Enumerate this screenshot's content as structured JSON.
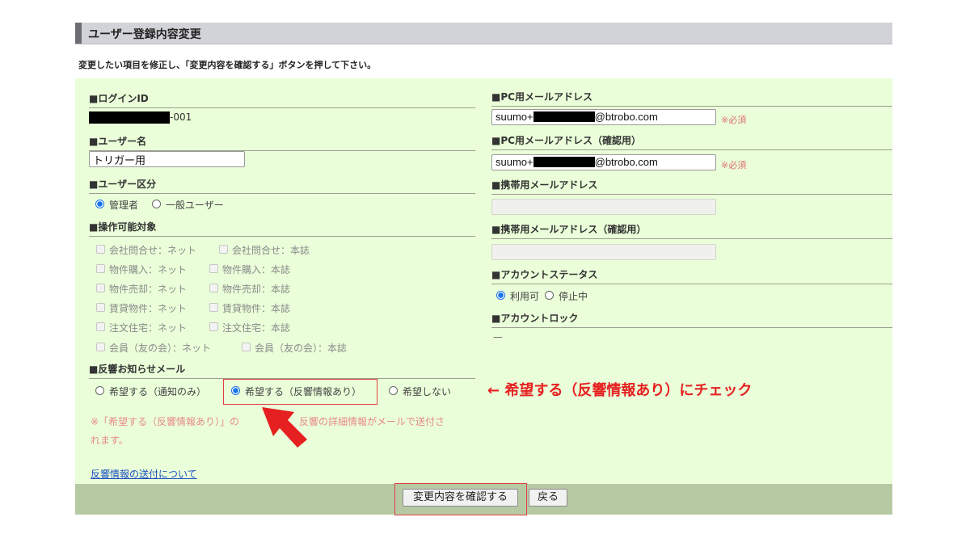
{
  "title": "ユーザー登録内容変更",
  "instruction": "変更したい項目を修正し、「変更内容を確認する」ボタンを押して下さい。",
  "left": {
    "login_id": {
      "label": "■ログインID",
      "value_suffix": "-001"
    },
    "user_name": {
      "label": "■ユーザー名",
      "value": "トリガー用"
    },
    "user_type": {
      "label": "■ユーザー区分",
      "options": [
        "管理者",
        "一般ユーザー"
      ],
      "selected": "管理者"
    },
    "operable": {
      "label": "■操作可能対象",
      "items": [
        [
          "会社問合せ：ネット",
          "会社問合せ：本誌"
        ],
        [
          "物件購入：ネット",
          "物件購入：本誌"
        ],
        [
          "物件売却：ネット",
          "物件売却：本誌"
        ],
        [
          "賃貸物件：ネット",
          "賃貸物件：本誌"
        ],
        [
          "注文住宅：ネット",
          "注文住宅：本誌"
        ],
        [
          "会員（友の会）：ネット",
          "会員（友の会）：本誌"
        ]
      ]
    },
    "notify_mail": {
      "label": "■反響お知らせメール",
      "options": [
        "希望する（通知のみ）",
        "希望する（反響情報あり）",
        "希望しない"
      ],
      "selected": "希望する（反響情報あり）",
      "note_a": "※「希望する（反響情報あり）」の",
      "note_b": "反響の詳細情報がメールで送付さ",
      "note_c": "れます。",
      "link": "反響情報の送付について"
    }
  },
  "right": {
    "pc_mail": {
      "label": "■PC用メールアドレス",
      "prefix": "suumo+",
      "suffix": "@btrobo.com",
      "required": "※必須"
    },
    "pc_mail_confirm": {
      "label": "■PC用メールアドレス（確認用）",
      "prefix": "suumo+",
      "suffix": "@btrobo.com",
      "required": "※必須"
    },
    "mobile_mail": {
      "label": "■携帯用メールアドレス"
    },
    "mobile_mail_confirm": {
      "label": "■携帯用メールアドレス（確認用）"
    },
    "account_status": {
      "label": "■アカウントステータス",
      "options": [
        "利用可",
        "停止中"
      ],
      "selected": "利用可"
    },
    "account_lock": {
      "label": "■アカウントロック",
      "value": "—"
    }
  },
  "annotation": "← 希望する（反響情報あり）にチェック",
  "buttons": {
    "confirm": "変更内容を確認する",
    "back": "戻る"
  },
  "colors": {
    "panel": "#eafed9",
    "footer": "#b7c9a3",
    "annotation": "#e62020",
    "arrow": "#e62020"
  }
}
